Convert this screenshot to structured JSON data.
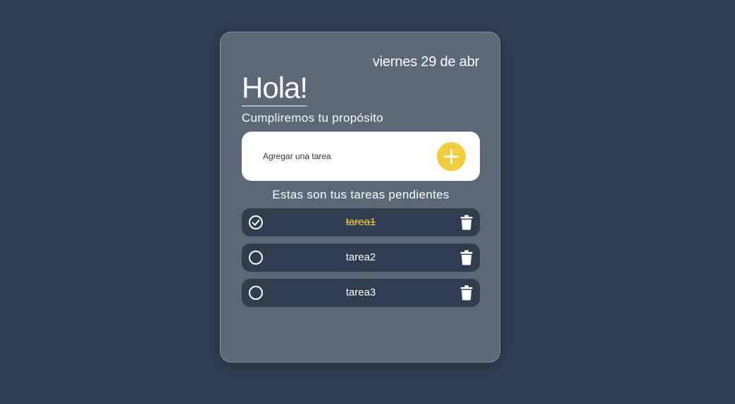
{
  "header": {
    "date": "viernes 29 de abr",
    "greeting": "Hola!",
    "subtitle": "Cumpliremos tu propósito"
  },
  "add_task": {
    "placeholder": "Agregar una tarea",
    "button_icon": "plus-icon"
  },
  "tasks_section": {
    "title": "Estas son tus tareas pendientes"
  },
  "tasks": [
    {
      "label": "tarea1",
      "done": true
    },
    {
      "label": "tarea2",
      "done": false
    },
    {
      "label": "tarea3",
      "done": false
    }
  ],
  "colors": {
    "background": "#2e3d50",
    "card": "#5a6878",
    "accent": "#f3cc3c",
    "task_bg": "#2e3d50"
  }
}
